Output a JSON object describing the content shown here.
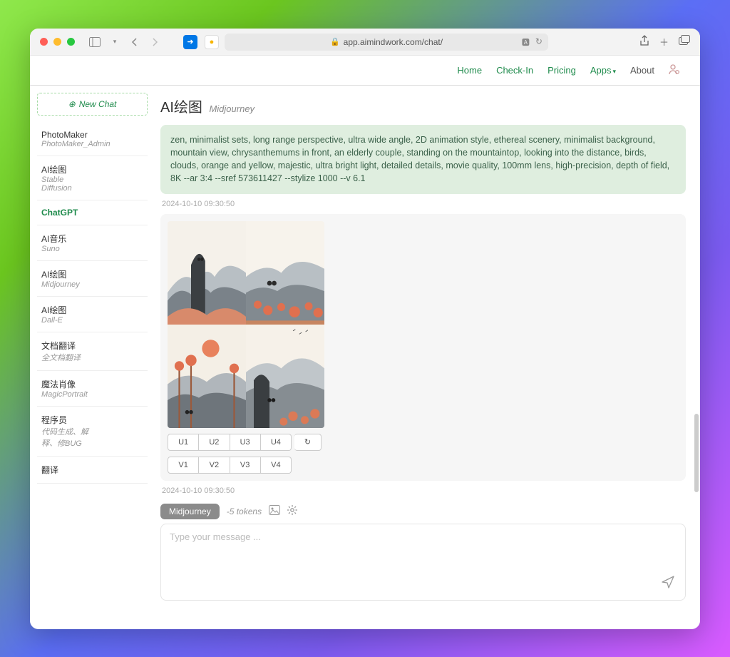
{
  "browser": {
    "url": "app.aimindwork.com/chat/"
  },
  "nav": {
    "home": "Home",
    "checkin": "Check-In",
    "pricing": "Pricing",
    "apps": "Apps",
    "about": "About"
  },
  "sidebar": {
    "new_chat": "New Chat",
    "items": [
      {
        "title": "PhotoMaker",
        "sub": "PhotoMaker_Admin"
      },
      {
        "title": "AI绘图",
        "sub": "Stable Diffusion"
      },
      {
        "title": "ChatGPT",
        "sub": ""
      },
      {
        "title": "AI音乐",
        "sub": "Suno"
      },
      {
        "title": "AI绘图",
        "sub": "Midjourney"
      },
      {
        "title": "AI绘图",
        "sub": "Dall-E"
      },
      {
        "title": "文档翻译",
        "sub": "全文档翻译"
      },
      {
        "title": "魔法肖像",
        "sub": "MagicPortrait"
      },
      {
        "title": "程序员",
        "sub": "代码生成、解释、修BUG"
      },
      {
        "title": "翻译",
        "sub": ""
      }
    ]
  },
  "page": {
    "title": "AI绘图",
    "subtitle": "Midjourney"
  },
  "prompt": "zen, minimalist sets, long range perspective, ultra wide angle, 2D animation style, ethereal scenery, minimalist background, mountain view, chrysanthemums in front, an elderly couple, standing on the mountaintop, looking into the distance, birds, clouds, orange and yellow, majestic, ultra bright light, detailed details, movie quality, 100mm lens, high-precision, depth of field, 8K --ar 3:4 --sref 573611427 --stylize 1000 --v 6.1",
  "timestamps": {
    "prompt": "2024-10-10 09:30:50",
    "reply": "2024-10-10 09:30:50"
  },
  "buttons": {
    "u": [
      "U1",
      "U2",
      "U3",
      "U4"
    ],
    "v": [
      "V1",
      "V2",
      "V3",
      "V4"
    ],
    "refresh": "↻"
  },
  "composer": {
    "model_chip": "Midjourney",
    "tokens": "-5 tokens",
    "placeholder": "Type your message ..."
  }
}
